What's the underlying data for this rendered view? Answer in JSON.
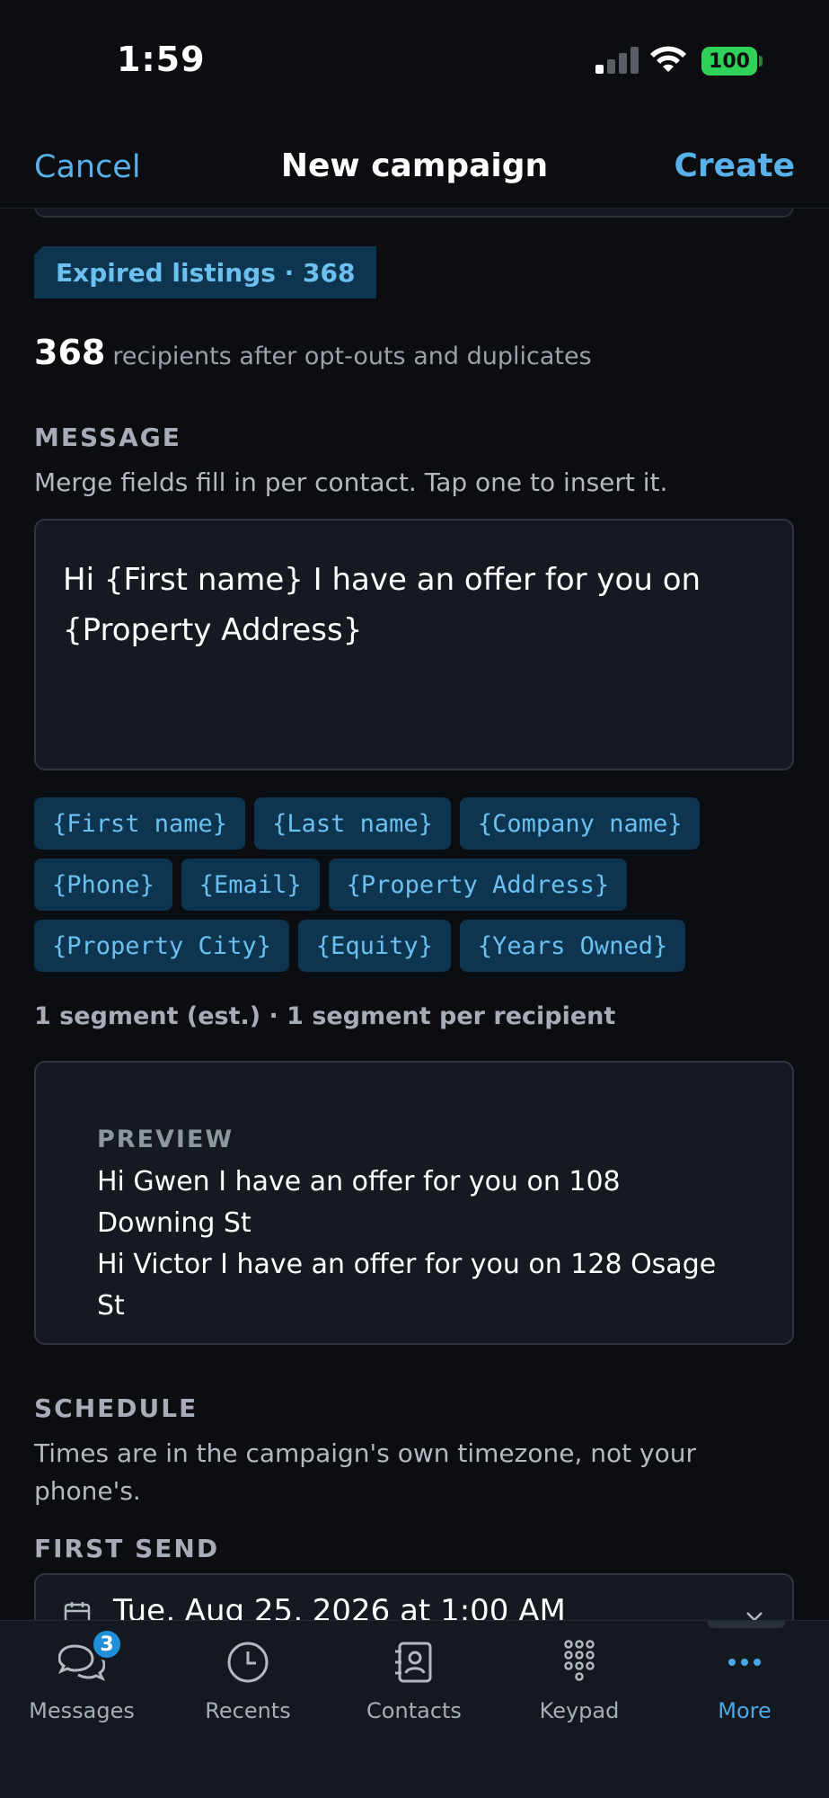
{
  "status_bar": {
    "time": "1:59",
    "battery": "100"
  },
  "nav": {
    "cancel": "Cancel",
    "title": "New campaign",
    "create": "Create"
  },
  "audience": {
    "segment_tag": "Expired listings · 368",
    "recipient_count": "368",
    "recipient_text": "recipients after opt-outs and duplicates"
  },
  "message": {
    "title": "MESSAGE",
    "description": "Merge fields fill in per contact. Tap one to insert it.",
    "body": "Hi {First name} I have an offer for you on {Property Address}",
    "merge_fields": [
      [
        "{First name}",
        "{Last name}",
        "{Company name}"
      ],
      [
        "{Phone}",
        "{Email}",
        "{Property Address}"
      ],
      [
        "{Property City}",
        "{Equity}",
        "{Years Owned}"
      ]
    ],
    "segment_info": "1 segment (est.) · 1 segment per recipient"
  },
  "preview": {
    "label": "PREVIEW",
    "lines": [
      "Hi Gwen I have an offer for you on 108 Downing St",
      "Hi Victor I have an offer for you on 128 Osage St"
    ]
  },
  "schedule": {
    "title": "SCHEDULE",
    "description": "Times are in the campaign's own timezone, not your phone's.",
    "first_send_label": "FIRST SEND",
    "first_send_value": "Tue, Aug 25, 2026 at 1:00 AM"
  },
  "tabs": [
    {
      "label": "Messages",
      "icon": "messages-icon",
      "badge": "3"
    },
    {
      "label": "Recents",
      "icon": "clock-icon"
    },
    {
      "label": "Contacts",
      "icon": "contacts-icon"
    },
    {
      "label": "Keypad",
      "icon": "keypad-icon"
    },
    {
      "label": "More",
      "icon": "more-icon",
      "active": true
    }
  ],
  "colors": {
    "accent": "#5ab0e8",
    "chip_bg": "#0e3550",
    "chip_text": "#6cc0ef",
    "background": "#0b0d10",
    "card": "#151a21"
  }
}
